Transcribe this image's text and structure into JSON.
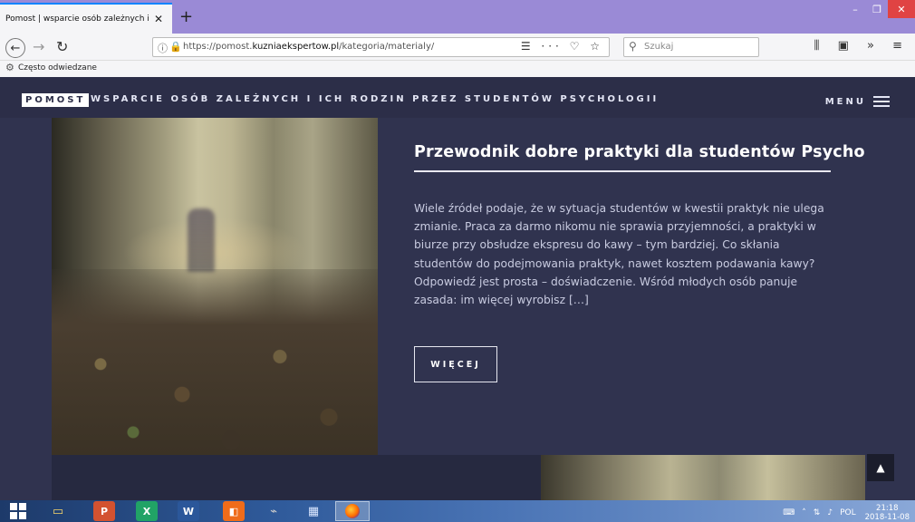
{
  "browser": {
    "tab_title": "Pomost | wsparcie osób zależnych i",
    "tab_close": "✕",
    "new_tab": "+",
    "window_buttons": {
      "minimize": "–",
      "restore": "❐",
      "close": "✕"
    },
    "url_prefix": "https://pomost.",
    "url_domain": "kuzniaekspertow.pl",
    "url_path": "/kategoria/materialy/",
    "url_actions": "☰ ··· ♡ ☆",
    "search_placeholder": "Szukaj",
    "toolbar_right": "⫼ ▣ » ≡",
    "bookmark_label": "Często odwiedzane"
  },
  "site": {
    "brand": "POMOST",
    "tagline": "WSPARCIE OSÓB ZALEŻNYCH I ICH RODZIN PRZEZ STUDENTÓW PSYCHOLOGII",
    "menu_label": "MENU"
  },
  "post": {
    "title": "Przewodnik dobre praktyki dla studentów Psychologii",
    "excerpt": "Wiele źródeł podaje, że w sytuacja studentów w kwestii praktyk nie ulega zmianie. Praca za darmo nikomu nie sprawia przyjemności, a praktyki w biurze przy obsłudze ekspresu do kawy – tym bardziej. Co skłania studentów do podejmowania praktyk, nawet kosztem podawania kawy? Odpowiedź jest prosta – doświadczenie. Wśród młodych osób panuje zasada: im więcej wyrobisz […]",
    "more_label": "WIĘCEJ"
  },
  "taskbar": {
    "apps": {
      "ppt": "P",
      "xls": "X",
      "word": "W",
      "other": "◧"
    },
    "tray_language": "POL",
    "clock_time": "21:18",
    "clock_date": "2018-11-08"
  },
  "colors": {
    "header_bg": "#2c2e48",
    "card_bg": "#30334f",
    "text_light": "#c8cbe0",
    "titlebar": "#9a8ad6"
  }
}
